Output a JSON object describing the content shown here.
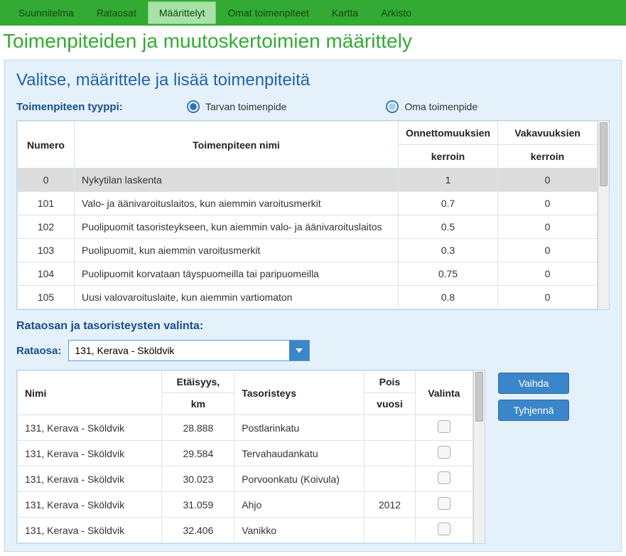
{
  "nav": {
    "items": [
      {
        "label": "Suunnitelma"
      },
      {
        "label": "Rataosat"
      },
      {
        "label": "Määrittelyt",
        "active": true
      },
      {
        "label": "Omat toimenpiteet"
      },
      {
        "label": "Kartta"
      },
      {
        "label": "Arkisto"
      }
    ]
  },
  "page": {
    "title": "Toimenpiteiden ja muutoskertoimien määrittely"
  },
  "section1": {
    "title": "Valitse, määrittele ja lisää toimenpiteitä",
    "type_label": "Toimenpiteen tyyppi:",
    "radios": {
      "tarva": "Tarvan toimenpide",
      "oma": "Oma toimenpide"
    }
  },
  "measures": {
    "headers": {
      "numero": "Numero",
      "nimi": "Toimenpiteen nimi",
      "onn_top": "Onnettomuuksien",
      "vak_top": "Vakavuuksien",
      "sub": "kerroin"
    },
    "rows": [
      {
        "num": "0",
        "name": "Nykytilan laskenta",
        "o": "1",
        "v": "0",
        "sel": true
      },
      {
        "num": "101",
        "name": "Valo- ja äänivaroituslaitos, kun aiemmin varoitusmerkit",
        "o": "0.7",
        "v": "0"
      },
      {
        "num": "102",
        "name": "Puolipuomit tasoristeykseen, kun aiemmin valo- ja äänivaroituslaitos",
        "o": "0.5",
        "v": "0"
      },
      {
        "num": "103",
        "name": "Puolipuomit, kun aiemmin varoitusmerkit",
        "o": "0.3",
        "v": "0"
      },
      {
        "num": "104",
        "name": "Puolipuomit korvataan täyspuomeilla tai paripuomeilla",
        "o": "0.75",
        "v": "0"
      },
      {
        "num": "105",
        "name": "Uusi valovaroituslaite, kun aiemmin vartiomaton",
        "o": "0.8",
        "v": "0"
      }
    ]
  },
  "section2": {
    "title": "Rataosan ja tasoristeysten valinta:",
    "rataosa_label": "Rataosa:",
    "rataosa_value": "131, Kerava - Sköldvik"
  },
  "crossings": {
    "headers": {
      "nimi": "Nimi",
      "et_top": "Etäisyys,",
      "et_sub": "km",
      "taso": "Tasoristeys",
      "pv_top": "Pois",
      "pv_sub": "vuosi",
      "valinta": "Valinta"
    },
    "rows": [
      {
        "nimi": "131, Kerava - Sköldvik",
        "et": "28.888",
        "taso": "Postlarinkatu",
        "pv": ""
      },
      {
        "nimi": "131, Kerava - Sköldvik",
        "et": "29.584",
        "taso": "Tervahaudankatu",
        "pv": ""
      },
      {
        "nimi": "131, Kerava - Sköldvik",
        "et": "30.023",
        "taso": "Porvoonkatu (Koivula)",
        "pv": ""
      },
      {
        "nimi": "131, Kerava - Sköldvik",
        "et": "31.059",
        "taso": "Ahjo",
        "pv": "2012"
      },
      {
        "nimi": "131, Kerava - Sköldvik",
        "et": "32.406",
        "taso": "Vanikko",
        "pv": ""
      }
    ]
  },
  "buttons": {
    "vaihda": "Vaihda",
    "tyhjenna": "Tyhjennä"
  }
}
